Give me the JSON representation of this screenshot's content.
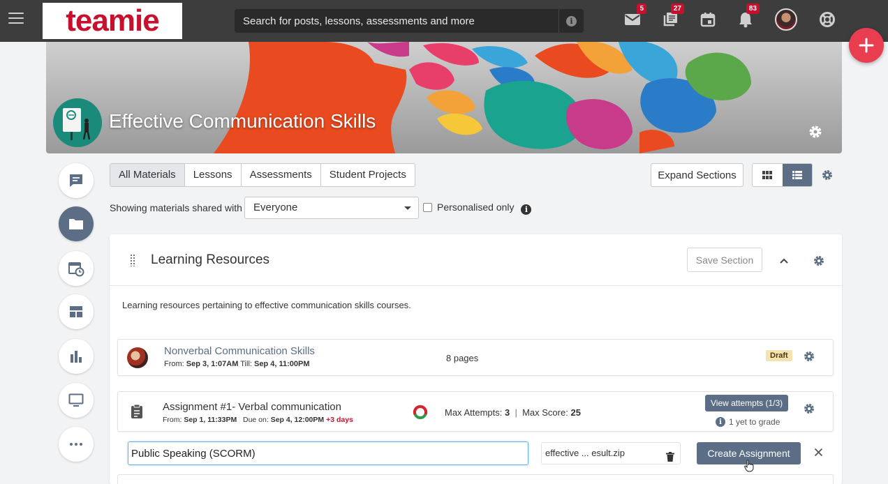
{
  "app": {
    "logo_text": "teamie",
    "brand_color": "#c8102e"
  },
  "topbar": {
    "search_placeholder": "Search for posts, lessons, assessments and more",
    "badges": {
      "messages": "5",
      "tasks": "27",
      "notifications": "83"
    }
  },
  "course": {
    "title": "Effective Communication Skills"
  },
  "tabs": [
    {
      "label": "All Materials",
      "active": true
    },
    {
      "label": "Lessons"
    },
    {
      "label": "Assessments"
    },
    {
      "label": "Student Projects"
    }
  ],
  "toolbar": {
    "expand_label": "Expand Sections"
  },
  "filter": {
    "label": "Showing materials shared with",
    "selected": "Everyone",
    "personalised_label": "Personalised only"
  },
  "section": {
    "title": "Learning Resources",
    "save_label": "Save Section",
    "description": "Learning resources pertaining to effective communication skills courses."
  },
  "items": [
    {
      "title": "Nonverbal Communication Skills",
      "from_label": "From:",
      "from": "Sep 3, 1:07AM",
      "till_label": "Till:",
      "till": "Sep 4, 11:00PM",
      "meta": "8 pages",
      "status": "Draft"
    },
    {
      "title": "Assignment #1- Verbal communication",
      "from_label": "From:",
      "from": "Sep 1, 11:33PM",
      "due_label": "Due on:",
      "due": "Sep 4, 12:00PM",
      "extra": "+3 days",
      "attempts_label": "Max Attempts:",
      "attempts": "3",
      "separator": "|",
      "score_label": "Max Score:",
      "score": "25",
      "view_label": "View attempts (1/3)",
      "grade_note": "1 yet to grade"
    }
  ],
  "new_assignment": {
    "title_value": "Public Speaking (SCORM)",
    "file_name": "effective ... esult.zip",
    "create_label": "Create Assignment"
  },
  "colors": {
    "accent": "#5b6e85",
    "fab": "#e83e50",
    "due_extra": "#c8102e"
  }
}
